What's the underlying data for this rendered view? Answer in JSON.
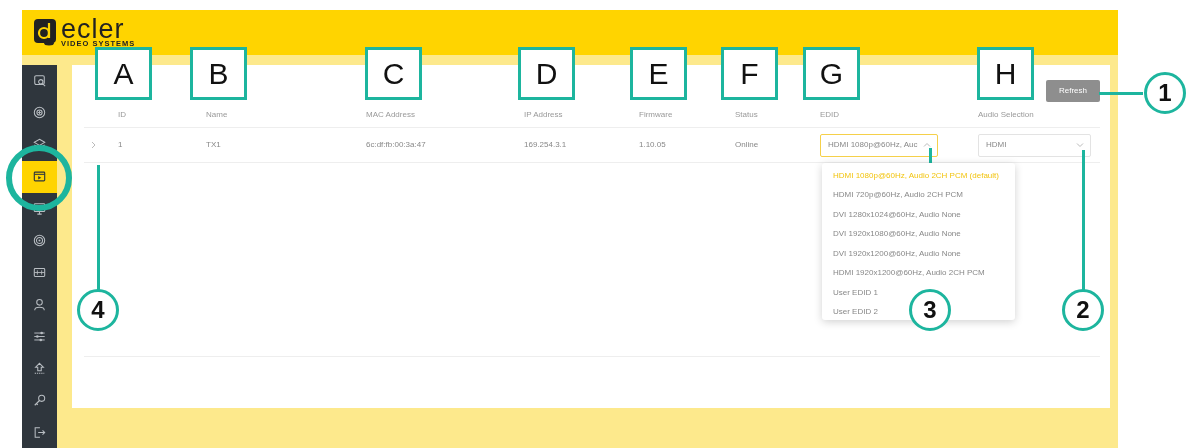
{
  "logo": {
    "brand": "ecler",
    "tagline": "VIDEO SYSTEMS"
  },
  "sidebar": {
    "items": [
      {
        "selected": false
      },
      {
        "selected": false
      },
      {
        "selected": false
      },
      {
        "selected": true
      },
      {
        "selected": false
      },
      {
        "selected": false
      },
      {
        "selected": false
      },
      {
        "selected": false
      },
      {
        "selected": false
      },
      {
        "selected": false
      },
      {
        "selected": false
      },
      {
        "selected": false
      }
    ]
  },
  "refresh_button": "Refresh",
  "table": {
    "columns": [
      "ID",
      "Name",
      "MAC Address",
      "IP Address",
      "Firmware",
      "Status",
      "EDID",
      "Audio Selection"
    ],
    "rows": [
      {
        "expanded": false,
        "cells": [
          "1",
          "TX1",
          "6c:df:fb:00:3a:47",
          "169.254.3.1",
          "1.10.05",
          "Online"
        ],
        "edid": {
          "value": "HDMI 1080p@60Hz, Auc",
          "open": true
        },
        "audio": {
          "value": "HDMI",
          "open": false
        }
      }
    ]
  },
  "edid_menu": [
    {
      "label": "HDMI 1080p@60Hz, Audio 2CH PCM (default)",
      "selected": true
    },
    {
      "label": "HDMI 720p@60Hz, Audio 2CH PCM",
      "selected": false
    },
    {
      "label": "DVI 1280x1024@60Hz, Audio None",
      "selected": false
    },
    {
      "label": "DVI 1920x1080@60Hz, Audio None",
      "selected": false
    },
    {
      "label": "DVI 1920x1200@60Hz, Audio None",
      "selected": false
    },
    {
      "label": "HDMI 1920x1200@60Hz, Audio 2CH PCM",
      "selected": false
    },
    {
      "label": "User EDID 1",
      "selected": false
    },
    {
      "label": "User EDID 2",
      "selected": false
    }
  ],
  "callouts": {
    "letters": [
      "A",
      "B",
      "C",
      "D",
      "E",
      "F",
      "G",
      "H"
    ],
    "numbers": [
      "1",
      "4",
      "3",
      "2"
    ]
  }
}
